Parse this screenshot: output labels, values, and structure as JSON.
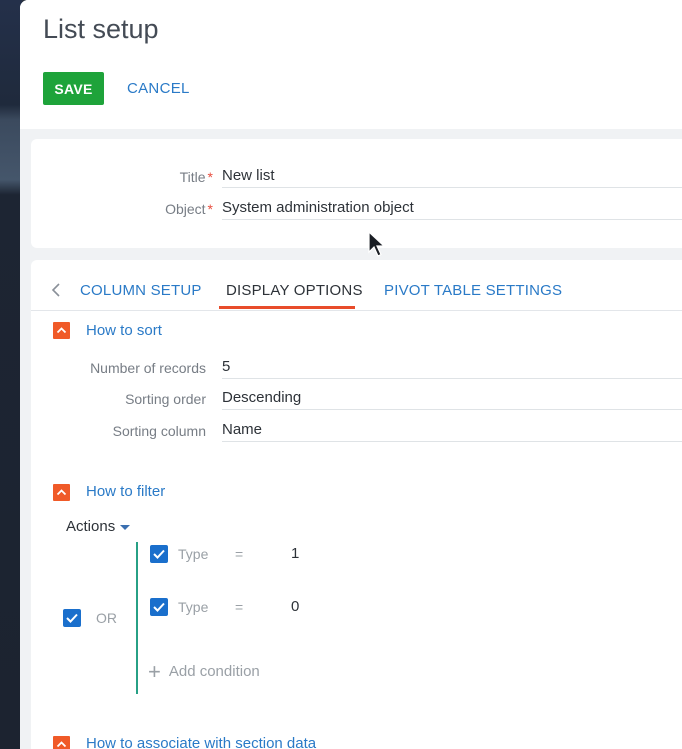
{
  "page": {
    "title": "List setup",
    "save_label": "SAVE",
    "cancel_label": "CANCEL"
  },
  "general": {
    "title_label": "Title",
    "title_value": "New list",
    "object_label": "Object",
    "object_value": "System administration object",
    "required_mark": "*"
  },
  "tabs": [
    {
      "label": "COLUMN SETUP",
      "active": false
    },
    {
      "label": "DISPLAY OPTIONS",
      "active": true
    },
    {
      "label": "PIVOT TABLE SETTINGS",
      "active": false
    }
  ],
  "sort": {
    "title": "How to sort",
    "fields": [
      {
        "label": "Number of records",
        "value": "5"
      },
      {
        "label": "Sorting order",
        "value": "Descending"
      },
      {
        "label": "Sorting column",
        "value": "Name"
      }
    ]
  },
  "filter": {
    "title": "How to filter",
    "actions_label": "Actions",
    "group_operator": "OR",
    "conditions": [
      {
        "column": "Type",
        "operator": "=",
        "value": "1",
        "checked": true
      },
      {
        "column": "Type",
        "operator": "=",
        "value": "0",
        "checked": true
      }
    ],
    "add_condition_label": "Add condition"
  },
  "associate": {
    "title": "How to associate with section data"
  },
  "colors": {
    "save_button": "#1ea33a",
    "link": "#2a7ac7",
    "active_tab_underline": "#e84c2a",
    "section_toggle": "#f05a28",
    "checkbox": "#1a6fcc",
    "group_line": "#27a085"
  }
}
